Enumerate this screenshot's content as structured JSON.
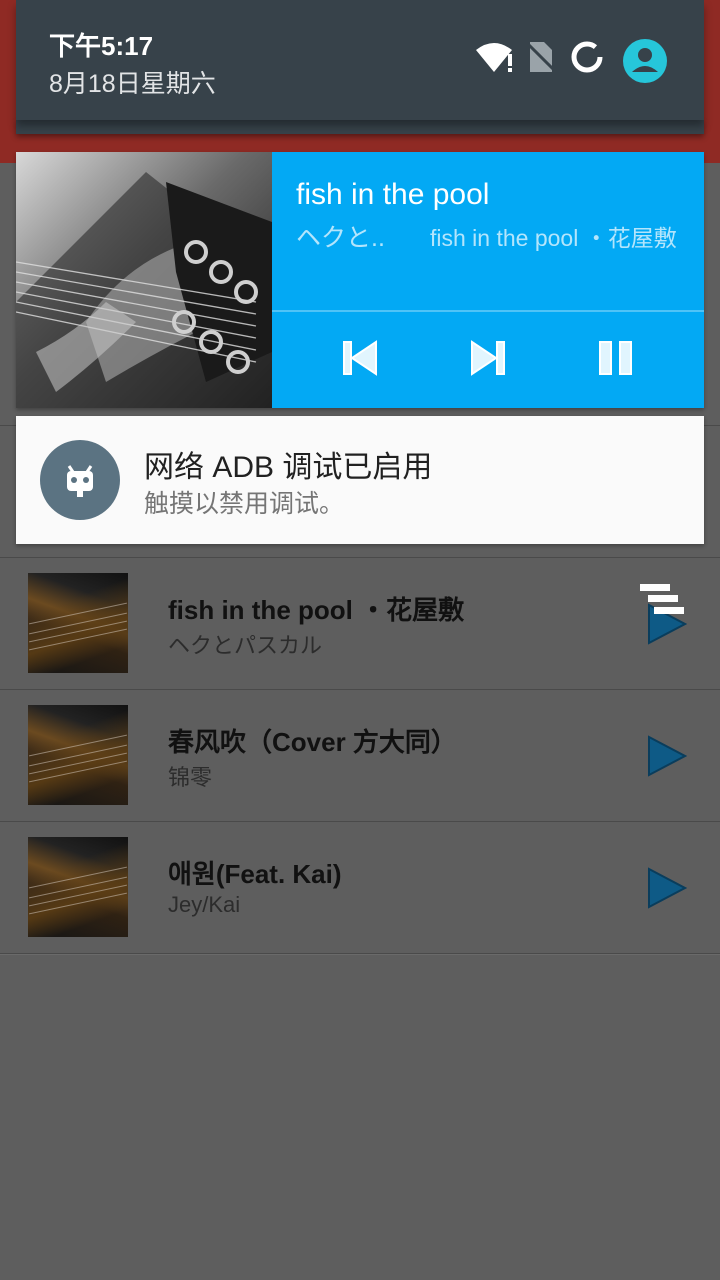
{
  "status": {
    "time": "下午5:17",
    "date": "8月18日星期六",
    "icons": [
      "wifi-no-internet-icon",
      "no-sim-icon",
      "data-saver-icon",
      "user-account-icon"
    ]
  },
  "media": {
    "title": "fish in the pool",
    "artist": "ヘクと..",
    "album": "fish in the pool ・花屋敷",
    "controls": [
      "skip-previous-icon",
      "skip-next-icon",
      "pause-icon"
    ],
    "accent": "#03a9f4"
  },
  "adb": {
    "title": "网络 ADB 调试已启用",
    "text": "触摸以禁用调试。"
  },
  "songs": [
    {
      "title": "fish in the pool ・花屋敷",
      "artist": "ヘクとパスカル"
    },
    {
      "title": "春风吹（Cover 方大同）",
      "artist": "锦零"
    },
    {
      "title": "애원(Feat. Kai)",
      "artist": "Jey/Kai"
    }
  ]
}
